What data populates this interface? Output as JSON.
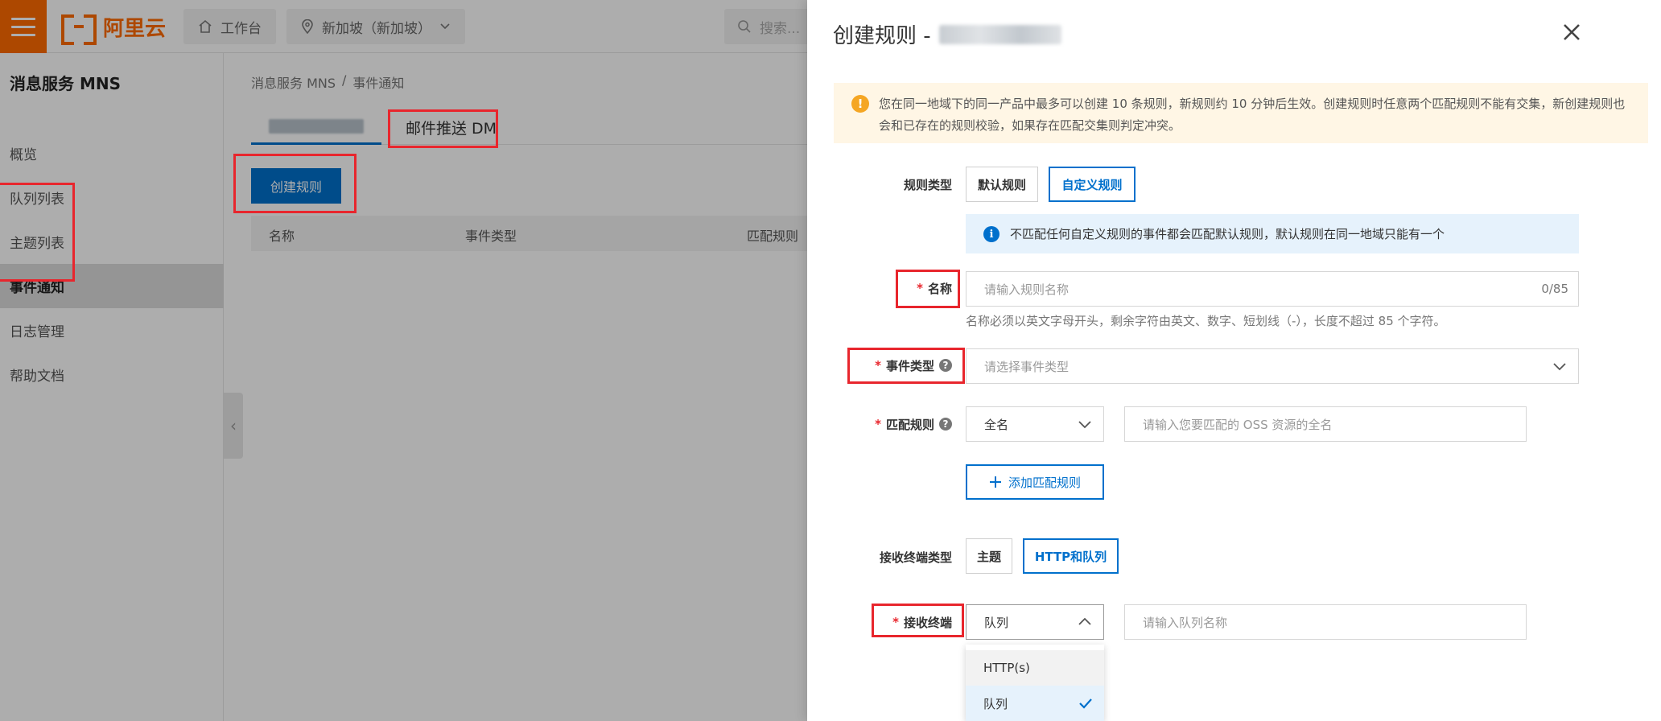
{
  "topbar": {
    "logo_text": "阿里云",
    "workbench_label": "工作台",
    "region_label": "新加坡（新加坡）",
    "search_placeholder": "搜索..."
  },
  "sidebar": {
    "title": "消息服务 MNS",
    "items": [
      {
        "label": "概览"
      },
      {
        "label": "队列列表"
      },
      {
        "label": "主题列表"
      },
      {
        "label": "事件通知"
      },
      {
        "label": "日志管理"
      },
      {
        "label": "帮助文档"
      }
    ]
  },
  "main": {
    "breadcrumb": {
      "root": "消息服务 MNS",
      "separator": "/",
      "current": "事件通知"
    },
    "tabs": [
      {
        "label": ""
      },
      {
        "label": "邮件推送 DM"
      }
    ],
    "create_button": "创建规则",
    "table_columns": [
      "名称",
      "事件类型",
      "匹配规则"
    ]
  },
  "drawer": {
    "title_prefix": "创建规则 -",
    "warning_text": "您在同一地域下的同一产品中最多可以创建 10 条规则，新规则约 10 分钟后生效。创建规则时任意两个匹配规则不能有交集，新创建规则也会和已存在的规则校验，如果存在匹配交集则判定冲突。",
    "rule_type": {
      "label": "规则类型",
      "options": [
        "默认规则",
        "自定义规则"
      ],
      "selected": "自定义规则",
      "info": "不匹配任何自定义规则的事件都会匹配默认规则，默认规则在同一地域只能有一个"
    },
    "name": {
      "label": "名称",
      "placeholder": "请输入规则名称",
      "counter": "0/85",
      "hint": "名称必须以英文字母开头，剩余字符由英文、数字、短划线（-），长度不超过 85 个字符。"
    },
    "event_type": {
      "label": "事件类型",
      "placeholder": "请选择事件类型"
    },
    "match_rule": {
      "label": "匹配规则",
      "select_value": "全名",
      "input_placeholder": "请输入您要匹配的 OSS 资源的全名",
      "add_button": "添加匹配规则"
    },
    "endpoint_type": {
      "label": "接收终端类型",
      "options": [
        "主题",
        "HTTP和队列"
      ],
      "selected": "HTTP和队列"
    },
    "endpoint": {
      "label": "接收终端",
      "select_value": "队列",
      "input_placeholder": "请输入队列名称",
      "dropdown_options": [
        "HTTP(s)",
        "队列"
      ],
      "dropdown_selected": "队列"
    }
  },
  "colors": {
    "brand_orange": "#ff6a00",
    "primary_blue": "#0070cc",
    "highlight_red": "#e8262d"
  }
}
